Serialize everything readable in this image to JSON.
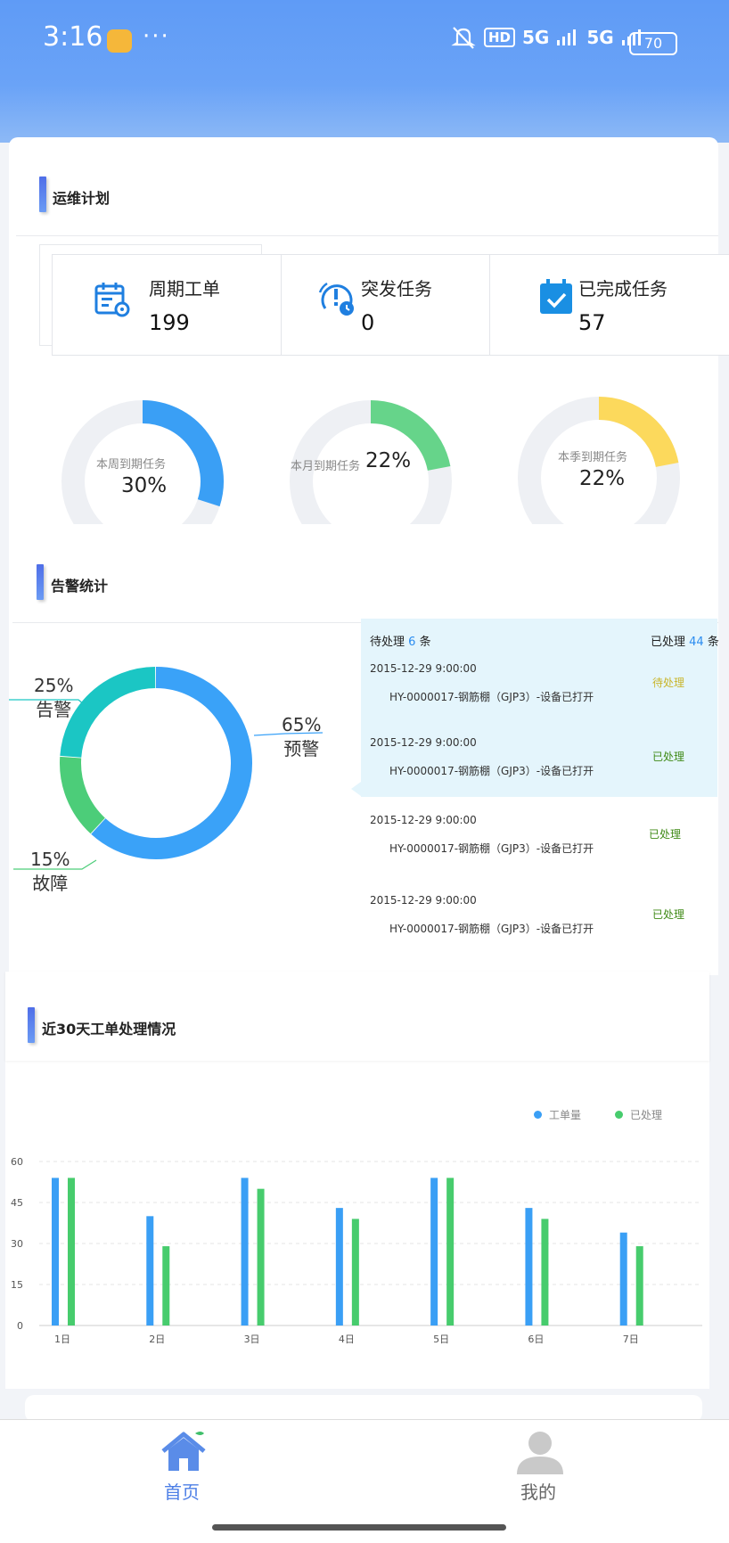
{
  "status_bar": {
    "time": "3:16",
    "dots": "···",
    "hd": "HD",
    "net1": "5G",
    "net2": "5G",
    "battery": "70"
  },
  "ops_plan": {
    "title": "运维计划",
    "stats": [
      {
        "label": "周期工单",
        "value": "199",
        "icon": "calendar-gear-icon"
      },
      {
        "label": "突发任务",
        "value": "0",
        "icon": "alarm-clock-icon"
      },
      {
        "label": "已完成任务",
        "value": "57",
        "icon": "calendar-check-icon"
      }
    ],
    "gauges": [
      {
        "label": "本周到期任务",
        "percent_text": "30%",
        "fraction": 0.3,
        "color": "#3a9ff5"
      },
      {
        "label": "本月到期任务",
        "percent_text": "22%",
        "fraction": 0.22,
        "color": "#66d48a"
      },
      {
        "label": "本季到期任务",
        "percent_text": "22%",
        "fraction": 0.22,
        "color": "#fcd95c"
      }
    ]
  },
  "alarm_stats": {
    "title": "告警统计",
    "donut": [
      {
        "label": "预警",
        "percent_text": "65%",
        "value": 65,
        "color": "#3aa2f8"
      },
      {
        "label": "故障",
        "percent_text": "15%",
        "value": 15,
        "color": "#4ccd79"
      },
      {
        "label": "告警",
        "percent_text": "25%",
        "value": 25,
        "color": "#1bc6c4"
      }
    ],
    "pending_prefix": "待处理",
    "pending_count": "6",
    "processed_prefix": "已处理",
    "processed_count": "44",
    "unit": "条",
    "items": [
      {
        "date": "2015-12-29 9:00:00",
        "desc": "HY-0000017-钢筋棚（GJP3）-设备已打开",
        "status": "待处理",
        "status_color": "#c9b52a"
      },
      {
        "date": "2015-12-29 9:00:00",
        "desc": "HY-0000017-钢筋棚（GJP3）-设备已打开",
        "status": "已处理",
        "status_color": "#3f8a16"
      },
      {
        "date": "2015-12-29 9:00:00",
        "desc": "HY-0000017-钢筋棚（GJP3）-设备已打开",
        "status": "已处理",
        "status_color": "#3f8a16"
      },
      {
        "date": "2015-12-29 9:00:00",
        "desc": "HY-0000017-钢筋棚（GJP3）-设备已打开",
        "status": "已处理",
        "status_color": "#3f8a16"
      }
    ]
  },
  "work_orders": {
    "title": "近30天工单处理情况",
    "chart_data": {
      "type": "bar",
      "categories": [
        "1日",
        "2日",
        "3日",
        "4日",
        "5日",
        "6日",
        "7日"
      ],
      "series": [
        {
          "name": "工单量",
          "color": "#3a9ff5",
          "values": [
            54,
            40,
            54,
            43,
            54,
            43,
            34
          ]
        },
        {
          "name": "已处理",
          "color": "#47cc6d",
          "values": [
            54,
            29,
            50,
            39,
            54,
            39,
            29
          ]
        }
      ],
      "yticks": [
        0,
        15,
        30,
        45,
        60
      ],
      "ylim": [
        0,
        60
      ],
      "grid": true,
      "legend_position": "top-right"
    }
  },
  "tabbar": {
    "items": [
      {
        "label": "首页",
        "icon": "home-icon",
        "active": true,
        "color": "#4d7fe6"
      },
      {
        "label": "我的",
        "icon": "user-icon",
        "active": false,
        "color": "#666666"
      }
    ]
  }
}
